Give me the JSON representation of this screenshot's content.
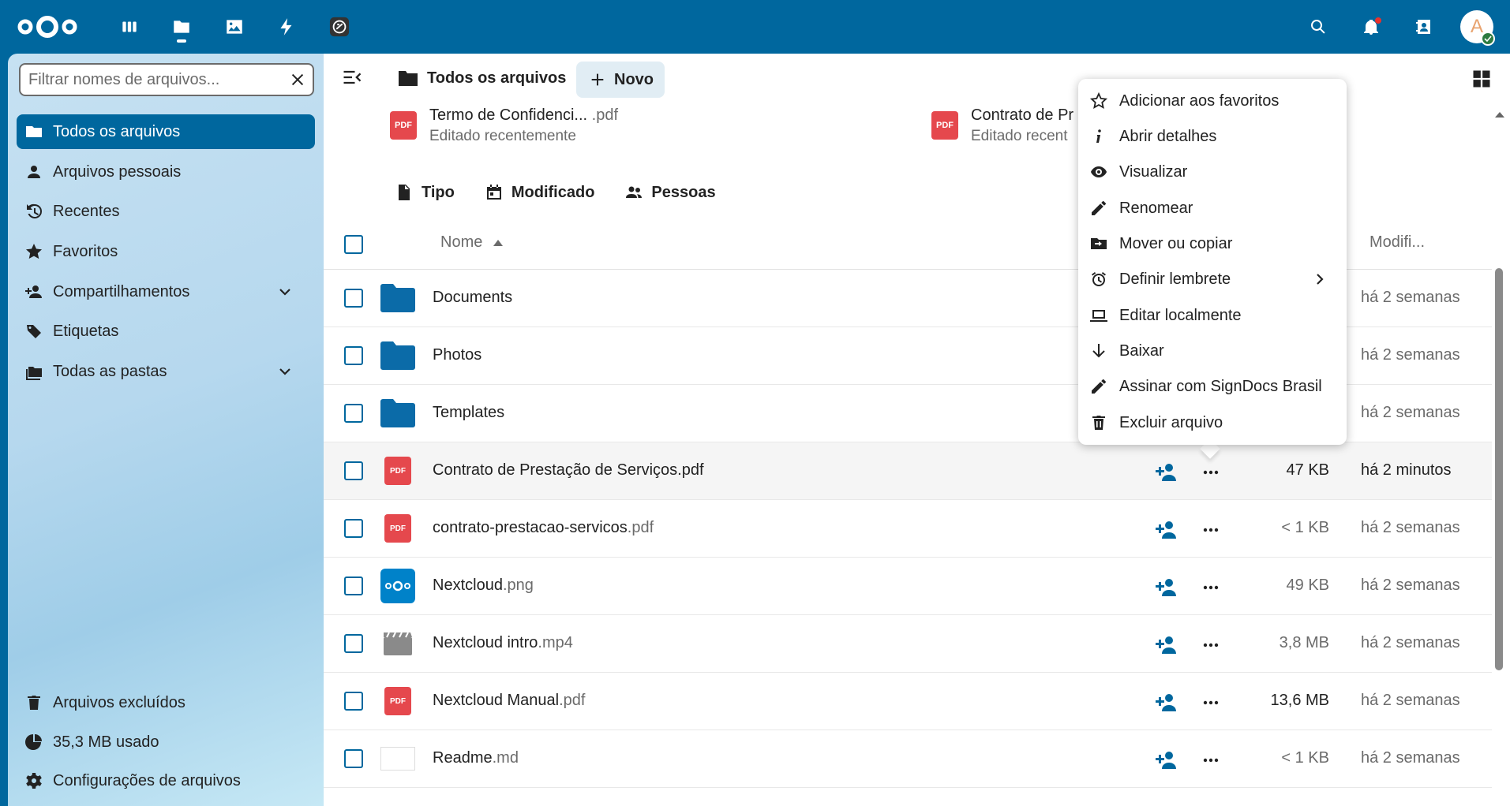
{
  "header": {
    "avatar_initial": "A"
  },
  "sidebar": {
    "filter_placeholder": "Filtrar nomes de arquivos...",
    "items": [
      {
        "label": "Todos os arquivos"
      },
      {
        "label": "Arquivos pessoais"
      },
      {
        "label": "Recentes"
      },
      {
        "label": "Favoritos"
      },
      {
        "label": "Compartilhamentos"
      },
      {
        "label": "Etiquetas"
      },
      {
        "label": "Todas as pastas"
      }
    ],
    "footer": [
      {
        "label": "Arquivos excluídos"
      },
      {
        "label": "35,3 MB usado"
      },
      {
        "label": "Configurações de arquivos"
      }
    ]
  },
  "main": {
    "breadcrumb": "Todos os arquivos",
    "new_button": "Novo",
    "recent": [
      {
        "name": "Termo de Confidenci...",
        "ext": " .pdf",
        "sub": "Editado recentemente"
      },
      {
        "name": "Contrato de Pr",
        "ext": "",
        "sub": "Editado recent"
      }
    ],
    "filters": [
      "Tipo",
      "Modificado",
      "Pessoas"
    ],
    "columns": {
      "name": "Nome",
      "modified": "Modifi..."
    },
    "files": [
      {
        "name": "Documents",
        "ext": "",
        "size": "",
        "modified": "há 2 semanas"
      },
      {
        "name": "Photos",
        "ext": "",
        "size": "",
        "modified": "há 2 semanas"
      },
      {
        "name": "Templates",
        "ext": "",
        "size": "",
        "modified": "há 2 semanas"
      },
      {
        "name": "Contrato de Prestação de Serviços.pdf",
        "ext": "",
        "size": "47 KB",
        "modified": "há 2 minutos"
      },
      {
        "name": "contrato-prestacao-servicos",
        "ext": ".pdf",
        "size": "< 1 KB",
        "modified": "há 2 semanas"
      },
      {
        "name": "Nextcloud",
        "ext": ".png",
        "size": "49 KB",
        "modified": "há 2 semanas"
      },
      {
        "name": "Nextcloud intro",
        "ext": ".mp4",
        "size": "3,8 MB",
        "modified": "há 2 semanas"
      },
      {
        "name": "Nextcloud Manual",
        "ext": ".pdf",
        "size": "13,6 MB",
        "modified": "há 2 semanas"
      },
      {
        "name": "Readme",
        "ext": ".md",
        "size": "< 1 KB",
        "modified": "há 2 semanas"
      }
    ]
  },
  "menu": {
    "items": [
      {
        "label": "Adicionar aos favoritos"
      },
      {
        "label": "Abrir detalhes"
      },
      {
        "label": "Visualizar"
      },
      {
        "label": "Renomear"
      },
      {
        "label": "Mover ou copiar"
      },
      {
        "label": "Definir lembrete"
      },
      {
        "label": "Editar localmente"
      },
      {
        "label": "Baixar"
      },
      {
        "label": "Assinar com SignDocs Brasil"
      },
      {
        "label": "Excluir arquivo"
      }
    ]
  },
  "icons": {
    "pdf_label": "PDF"
  },
  "colors": {
    "brand": "#00679e",
    "pdf": "#e5484d",
    "folder": "#0b6ba8"
  }
}
